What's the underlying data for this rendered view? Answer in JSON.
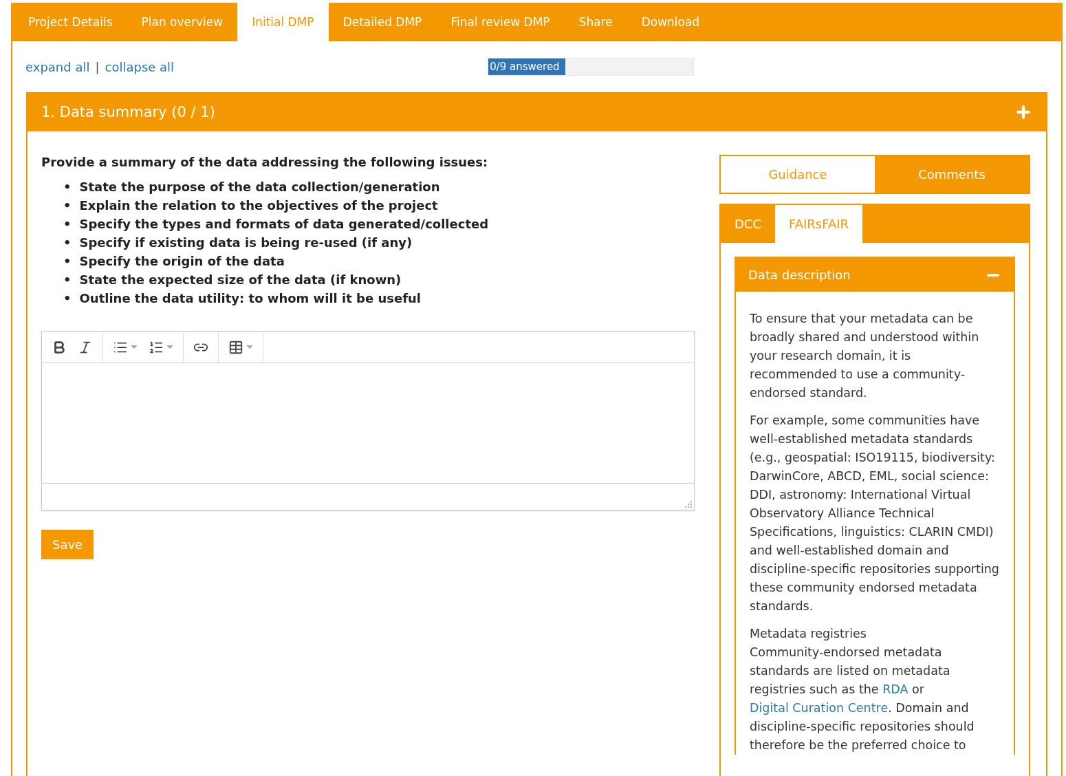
{
  "tabs": [
    {
      "label": "Project Details",
      "selected": false
    },
    {
      "label": "Plan overview",
      "selected": false
    },
    {
      "label": "Initial DMP",
      "selected": true
    },
    {
      "label": "Detailed DMP",
      "selected": false
    },
    {
      "label": "Final review DMP",
      "selected": false
    },
    {
      "label": "Share",
      "selected": false
    },
    {
      "label": "Download",
      "selected": false
    }
  ],
  "expand_links": {
    "expand": "expand all",
    "separator": "|",
    "collapse": "collapse all"
  },
  "progress": {
    "label": "0/9 answered",
    "level": 0.375
  },
  "section": {
    "title": "1. Data summary (0 / 1)"
  },
  "question": {
    "bullet": "•",
    "intro": "Provide a summary of the data addressing the following issues:",
    "items": [
      "State the purpose of the data collection/generation",
      "Explain the relation to the objectives of the project",
      "Specify the types and formats of data generated/collected",
      "Specify if existing data is being re-used (if any)",
      "Specify the origin of the data",
      "State the expected size of the data (if known)",
      "Outline the data utility: to whom will it be useful"
    ]
  },
  "editor": {
    "groups": [
      [
        {
          "kind": "bold"
        },
        {
          "kind": "italic"
        }
      ],
      [
        {
          "kind": "bullets"
        },
        {
          "kind": "numbers"
        }
      ],
      [
        {
          "kind": "link"
        }
      ],
      [
        {
          "kind": "table"
        }
      ]
    ]
  },
  "save_button": "Save",
  "panel_tabs": [
    {
      "label": "Guidance",
      "selected": true
    },
    {
      "label": "Comments",
      "selected": false
    }
  ],
  "guidance_tabs": [
    {
      "label": "DCC",
      "selected": false
    },
    {
      "label": "FAIRsFAIR",
      "selected": true
    }
  ],
  "accordion": {
    "title": "Data description",
    "expanded": true,
    "paragraphs": [
      {
        "segments": [
          {
            "kind": "text",
            "text": "To ensure that your metadata can be broadly shared and understood within your research domain, it is recommended to use a community-endorsed standard."
          }
        ]
      },
      {
        "segments": [
          {
            "kind": "text",
            "text": "For example, some communities have well-established metadata standards (e.g., geospatial: ISO19115, biodiversity: DarwinCore, ABCD, EML, social science: DDI, astronomy: International Virtual Observatory Alliance Technical Specifications, linguistics: CLARIN CMDI) and well-established domain and discipline-specific repositories supporting these community endorsed metadata standards."
          }
        ]
      },
      {
        "heading": "Metadata registries",
        "segments": [
          {
            "kind": "text",
            "text": "Community-endorsed metadata standards are listed on metadata registries such as the "
          },
          {
            "kind": "link",
            "text": "RDA"
          },
          {
            "kind": "text",
            "text": " or "
          },
          {
            "kind": "link",
            "text": "Digital Curation Centre"
          },
          {
            "kind": "text",
            "text": ". Domain and discipline-specific repositories should therefore be the preferred choice to"
          }
        ]
      }
    ]
  }
}
